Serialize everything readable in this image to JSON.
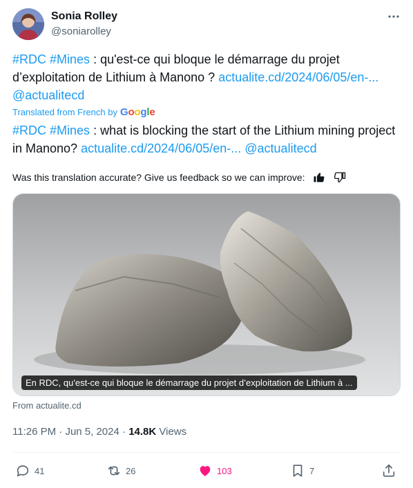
{
  "author": {
    "display_name": "Sonia Rolley",
    "handle": "@soniarolley"
  },
  "tweet": {
    "original": {
      "hashtag1": "#RDC",
      "hashtag2": "#Mines",
      "text": " : qu'est-ce qui bloque le démarrage du projet d’exploitation de Lithium à Manono ? ",
      "link": "actualite.cd/2024/06/05/en-...",
      "mention": "@actualitecd"
    },
    "translated_label": "Translated from French by",
    "translated_provider": "Google",
    "translated": {
      "hashtag1": "#RDC",
      "hashtag2": "#Mines",
      "text": " : what is blocking the start of the Lithium mining project in Manono? ",
      "link": "actualite.cd/2024/06/05/en-...",
      "mention": "@actualitecd"
    },
    "feedback_prompt": "Was this translation accurate? Give us feedback so we can improve:",
    "card": {
      "caption": "En RDC, qu'est-ce qui bloque le démarrage du projet d’exploitation de Lithium à ...",
      "source": "From actualite.cd"
    },
    "time": "11:26 PM",
    "date": "Jun 5, 2024",
    "views_count": "14.8K",
    "views_label": "Views"
  },
  "actions": {
    "replies": "41",
    "reposts": "26",
    "likes": "103",
    "bookmarks": "7"
  },
  "colors": {
    "link": "#1d9bf0",
    "like": "#f91880",
    "muted": "#536471"
  }
}
